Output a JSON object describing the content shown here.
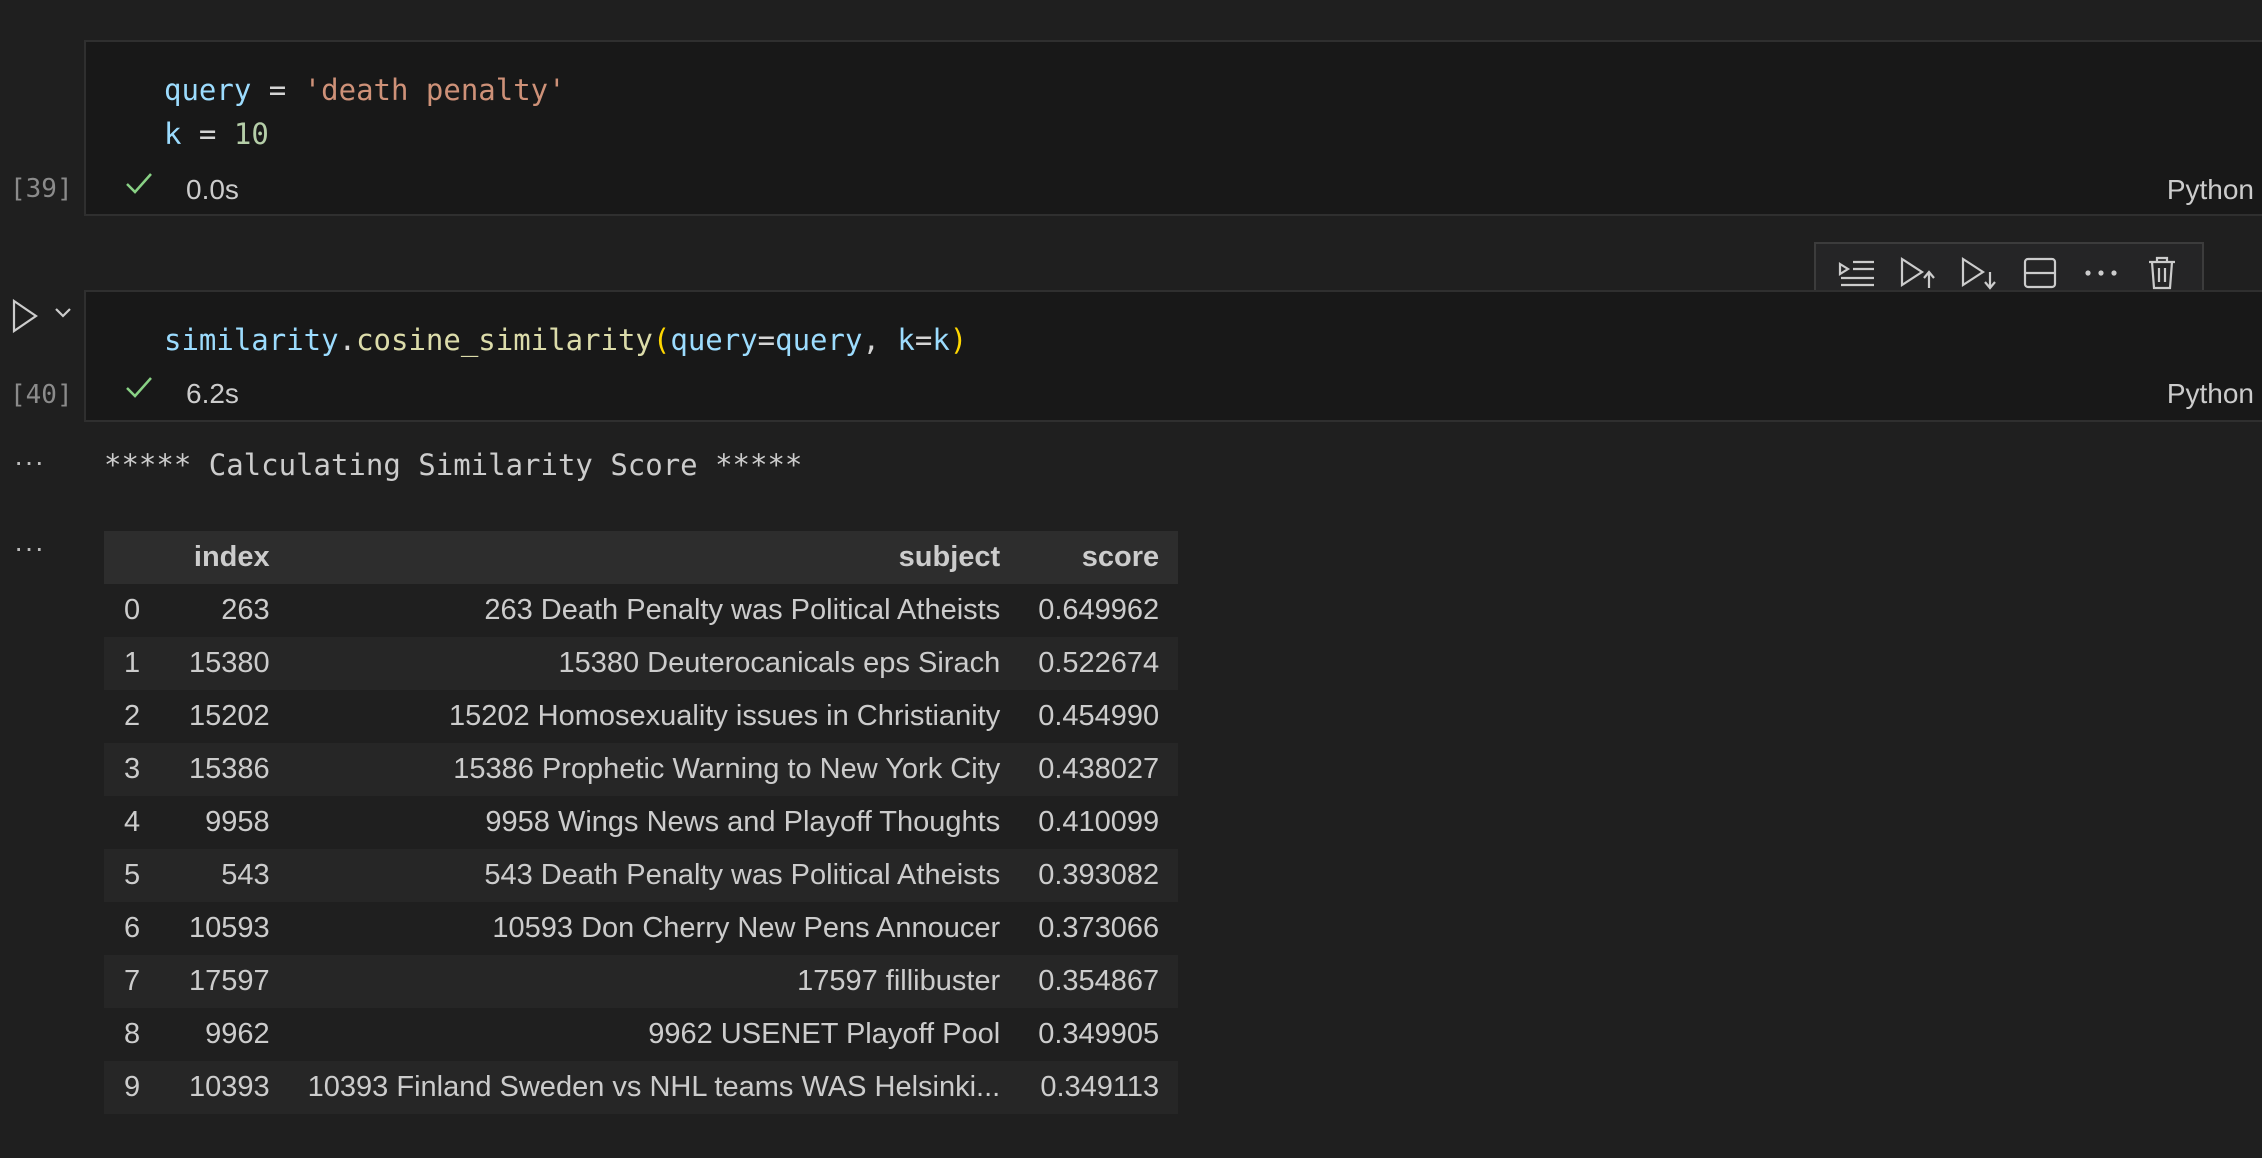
{
  "cell39": {
    "execution_count": "[39]",
    "line1": {
      "var": "query",
      "op": " = ",
      "str": "'death penalty'"
    },
    "line2": {
      "var": "k",
      "op": " = ",
      "num": "10"
    },
    "status_icon": "check-icon",
    "duration": "0.0s",
    "language": "Python"
  },
  "cell40": {
    "execution_count": "[40]",
    "code": {
      "obj": "similarity",
      "dot": ".",
      "fn": "cosine_similarity",
      "open": "(",
      "arg1": "query",
      "eq1": "=",
      "val1": "query",
      "comma": ", ",
      "arg2": "k",
      "eq2": "=",
      "val2": "k",
      "close": ")"
    },
    "status_icon": "check-icon",
    "duration": "6.2s",
    "language": "Python"
  },
  "toolbar": {
    "icons": [
      "execute-above-icon",
      "run-above-icon",
      "run-below-icon",
      "split-cell-icon",
      "more-icon",
      "delete-icon"
    ]
  },
  "output": {
    "more_label": "···",
    "stdout": "***** Calculating Similarity Score *****",
    "table": {
      "columns": [
        "",
        "index",
        "subject",
        "score"
      ],
      "rows": [
        [
          "0",
          "263",
          "263 Death Penalty was Political Atheists",
          "0.649962"
        ],
        [
          "1",
          "15380",
          "15380 Deuterocanicals eps Sirach",
          "0.522674"
        ],
        [
          "2",
          "15202",
          "15202 Homosexuality issues in Christianity",
          "0.454990"
        ],
        [
          "3",
          "15386",
          "15386 Prophetic Warning to New York City",
          "0.438027"
        ],
        [
          "4",
          "9958",
          "9958 Wings News and Playoff Thoughts",
          "0.410099"
        ],
        [
          "5",
          "543",
          "543 Death Penalty was Political Atheists",
          "0.393082"
        ],
        [
          "6",
          "10593",
          "10593 Don Cherry New Pens Annoucer",
          "0.373066"
        ],
        [
          "7",
          "17597",
          "17597 fillibuster",
          "0.354867"
        ],
        [
          "8",
          "9962",
          "9962 USENET Playoff Pool",
          "0.349905"
        ],
        [
          "9",
          "10393",
          "10393 Finland Sweden vs NHL teams WAS Helsinki...",
          "0.349113"
        ]
      ]
    }
  },
  "colors": {
    "background": "#1f1f1f",
    "cell_background": "#181818",
    "success": "#89d185",
    "string": "#ce9178",
    "variable": "#9cdcfe",
    "number": "#b5cea8",
    "function": "#dcdcaa"
  }
}
